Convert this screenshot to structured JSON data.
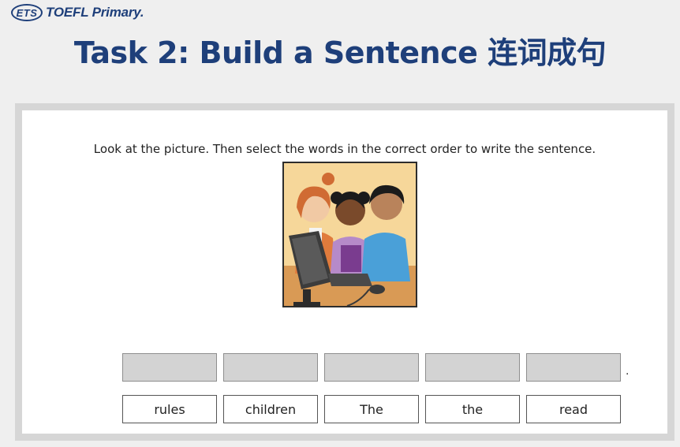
{
  "header": {
    "logo_text": "ETS",
    "brand_text": "TOEFL Primary.",
    "title": "Task 2: Build a Sentence 连词成句"
  },
  "task": {
    "instruction": "Look at the picture. Then select the words in the correct order to write the sentence.",
    "sentence_end": ".",
    "answer_slots": [
      "",
      "",
      "",
      "",
      ""
    ],
    "word_options": [
      "rules",
      "children",
      "The",
      "the",
      "read"
    ]
  },
  "colors": {
    "brand_blue": "#1e3f7a",
    "page_bg": "#efefef",
    "slot_gray": "#d3d3d3"
  }
}
